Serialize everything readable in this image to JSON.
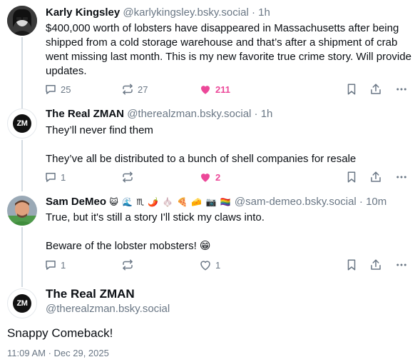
{
  "posts": [
    {
      "name": "Karly Kingsley",
      "handle": "@karlykingsley.bsky.social",
      "sep": " · ",
      "time": "1h",
      "paragraphs": [
        "$400,000 worth of lobsters have disappeared in Massachusetts after being shipped from a cold storage warehouse and that’s after a shipment of crab went missing last month. This is my new favorite true crime story. Will provide updates."
      ],
      "replies": "25",
      "reposts": "27",
      "likes": "211",
      "liked": true
    },
    {
      "name": "The Real ZMAN",
      "handle": "@therealzman.bsky.social",
      "sep": " · ",
      "time": "1h",
      "paragraphs": [
        "They’ll never find them",
        "They’ve all be distributed to a bunch of shell companies for resale"
      ],
      "replies": "1",
      "reposts": "",
      "likes": "2",
      "liked": true
    },
    {
      "name": "Sam DeMeo",
      "name_emojis": "😺 🌊 ♏ 🌶️ 🧄 🍕 🧀 📷 🏳️‍🌈",
      "handle": "@sam-demeo.bsky.social",
      "sep": " · ",
      "time": "10m",
      "paragraphs": [
        "True, but it's still a story I'll stick my claws into.",
        "Beware of the lobster mobsters!  😁"
      ],
      "replies": "1",
      "reposts": "",
      "likes": "1",
      "liked": false
    }
  ],
  "focus": {
    "name": "The Real ZMAN",
    "handle": "@therealzman.bsky.social",
    "text": "Snappy Comeback!",
    "timestamp": "11:09 AM · Dec 29, 2025"
  },
  "avatar_initials": "ZM",
  "icons": [
    "reply-icon",
    "repost-icon",
    "like-icon",
    "bookmark-icon",
    "share-icon",
    "more-icon"
  ],
  "colors": {
    "like": "#ec4899",
    "muted": "#6a7785",
    "text": "#0b0f14"
  }
}
